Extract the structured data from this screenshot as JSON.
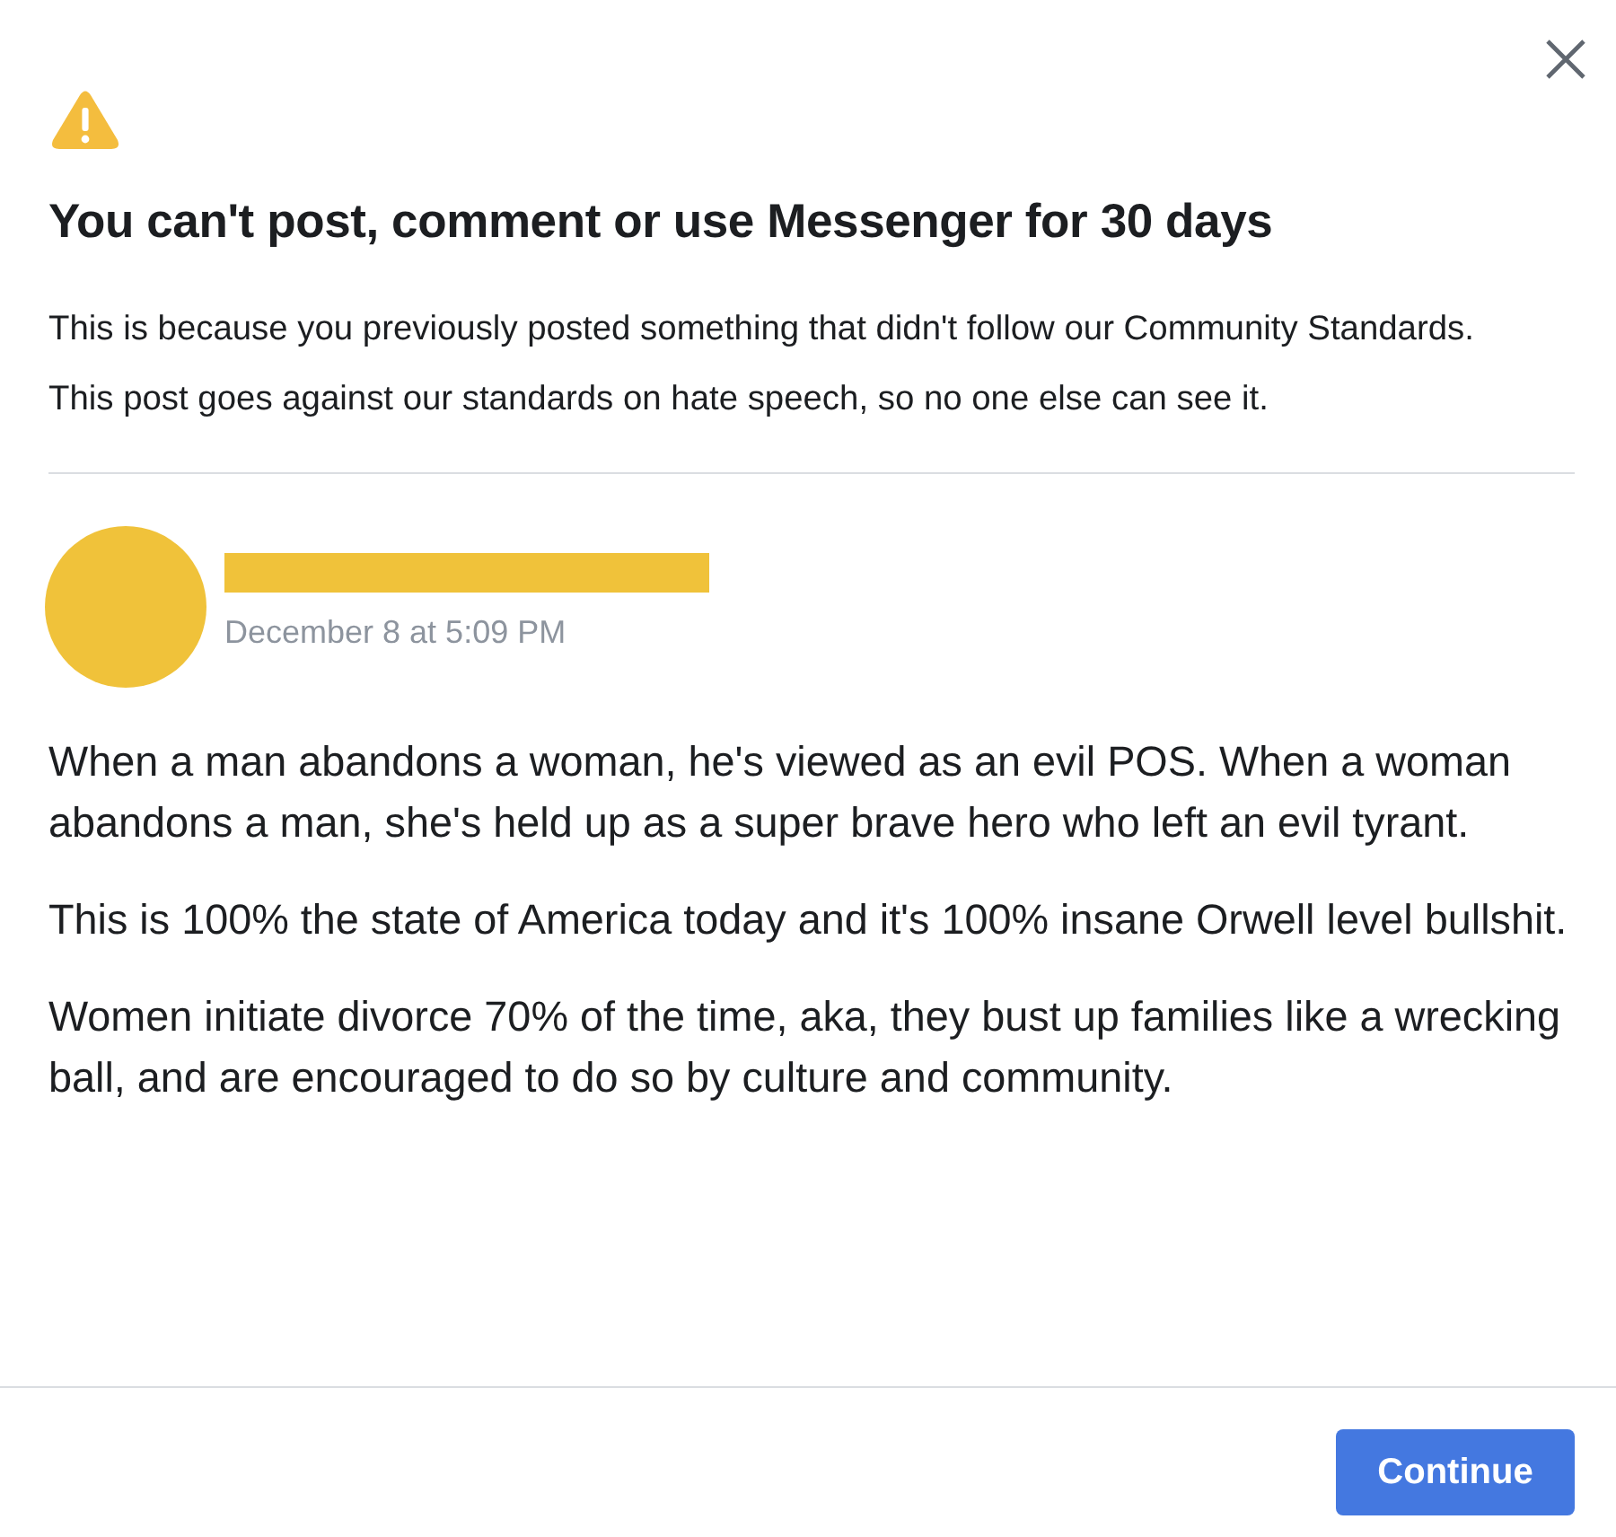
{
  "dialog": {
    "title": "You can't post, comment or use Messenger for 30 days",
    "paragraphs": [
      "This is because you previously posted something that didn't follow our Community Standards.",
      "This post goes against our standards on hate speech, so no one else can see it."
    ],
    "post": {
      "timestamp": "December 8 at 5:09 PM",
      "paragraphs": [
        "When a man abandons a woman, he's viewed as an evil POS. When a woman abandons a man, she's held up as a super brave hero who left an evil tyrant.",
        "This is 100% the state of America today and it's 100% insane Orwell level bullshit.",
        "Women initiate divorce 70% of the time, aka, they bust up families like a wrecking ball, and are encouraged to do so by culture and community."
      ]
    },
    "buttons": [
      "Continue"
    ]
  }
}
